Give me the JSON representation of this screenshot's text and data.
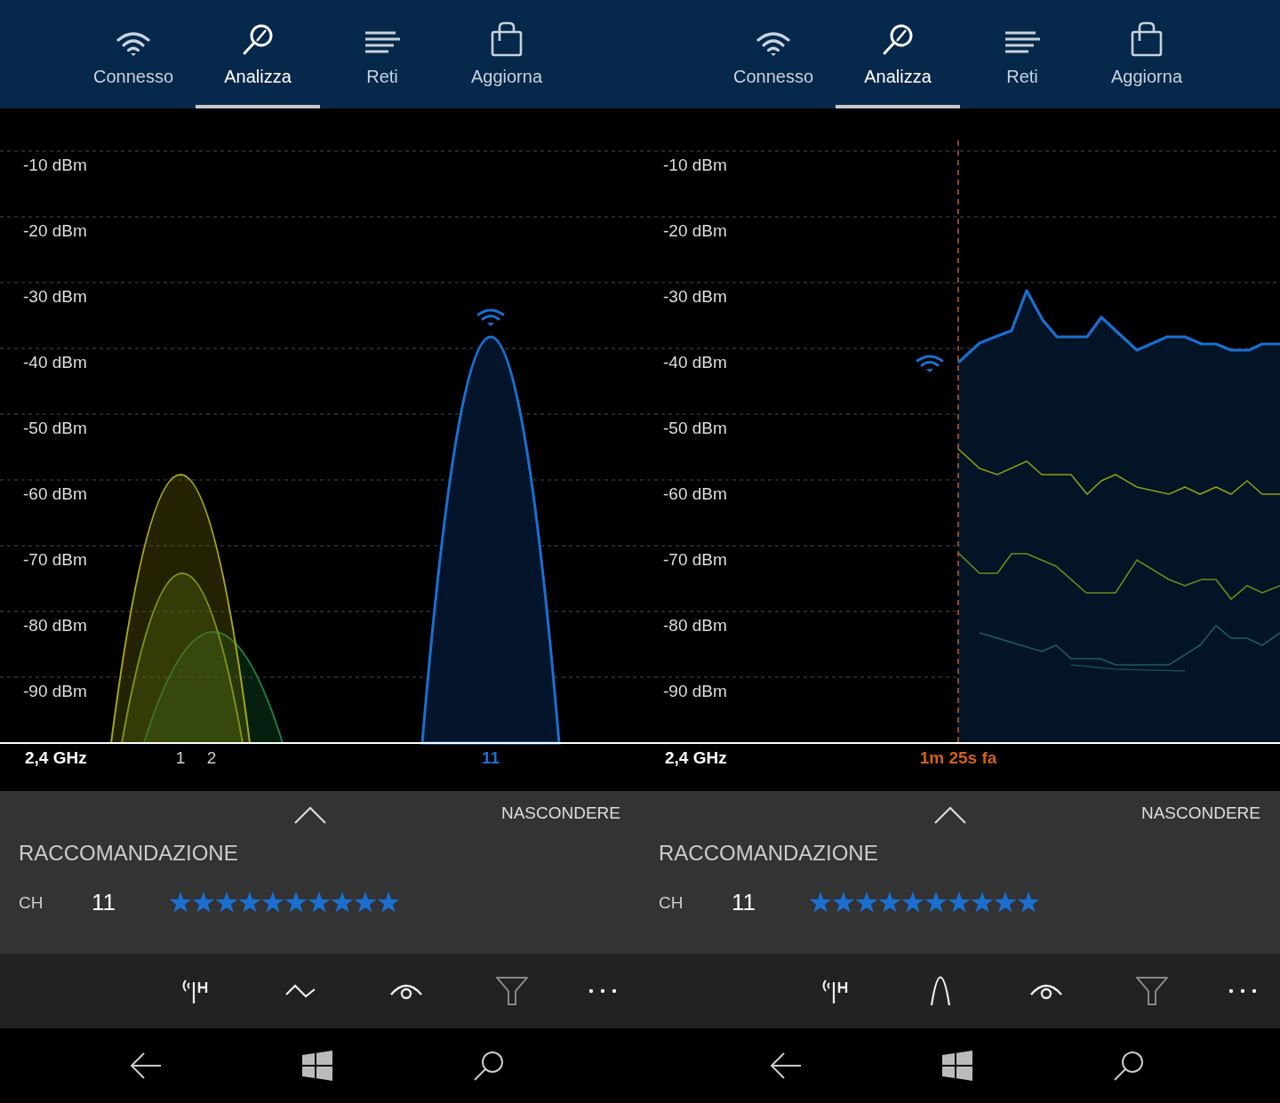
{
  "panels": [
    {
      "tabs": [
        {
          "label": "Connesso",
          "selected": false,
          "kind": "wifi"
        },
        {
          "label": "Analizza",
          "selected": true,
          "kind": "analyze"
        },
        {
          "label": "Reti",
          "selected": false,
          "kind": "list"
        },
        {
          "label": "Aggiorna",
          "selected": false,
          "kind": "bag"
        }
      ],
      "chart": {
        "kind": "spectrum",
        "y_ticks": [
          "-10 dBm",
          "-20 dBm",
          "-30 dBm",
          "-40 dBm",
          "-50 dBm",
          "-60 dBm",
          "-70 dBm",
          "-80 dBm",
          "-90 dBm"
        ],
        "band": "2,4 GHz",
        "x_labels": [
          {
            "text": "1",
            "kind": "channel"
          },
          {
            "text": "2",
            "kind": "channel"
          },
          {
            "text": "11",
            "kind": "connected"
          }
        ]
      },
      "recommendation": {
        "toggle": "NASCONDERE",
        "title": "RACCOMANDAZIONE",
        "channel_label": "CH",
        "channel": "11",
        "stars": 10
      }
    },
    {
      "tabs": [
        {
          "label": "Connesso",
          "selected": false,
          "kind": "wifi"
        },
        {
          "label": "Analizza",
          "selected": true,
          "kind": "analyze"
        },
        {
          "label": "Reti",
          "selected": false,
          "kind": "list"
        },
        {
          "label": "Aggiorna",
          "selected": false,
          "kind": "bag"
        }
      ],
      "chart": {
        "kind": "history",
        "y_ticks": [
          "-10 dBm",
          "-20 dBm",
          "-30 dBm",
          "-40 dBm",
          "-50 dBm",
          "-60 dBm",
          "-70 dBm",
          "-80 dBm",
          "-90 dBm"
        ],
        "band": "2,4 GHz",
        "x_labels": [
          {
            "text": "1m 25s fa",
            "kind": "time"
          }
        ]
      },
      "recommendation": {
        "toggle": "NASCONDERE",
        "title": "RACCOMANDAZIONE",
        "channel_label": "CH",
        "channel": "11",
        "stars": 10
      }
    }
  ]
}
